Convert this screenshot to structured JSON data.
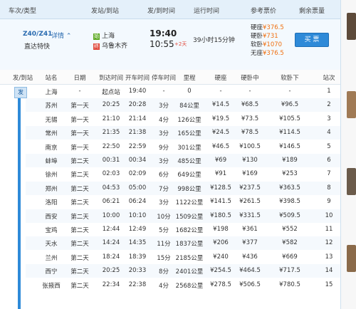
{
  "header": {
    "cols": [
      "车次/类型",
      "发站/到站",
      "发/到时间",
      "运行时间",
      "参考票价",
      "剩余票量"
    ]
  },
  "train": {
    "code": "Z40/Z41",
    "detail_label": "详情",
    "type": "直达特快",
    "from_tag": "始",
    "from": "上海",
    "to_tag": "终",
    "to": "乌鲁木齐",
    "depart": "19:40",
    "arrive": "10:55",
    "plus_days": "+2天",
    "duration": "39小时15分钟",
    "fares": [
      {
        "label": "硬座",
        "price": "¥376.5"
      },
      {
        "label": "硬卧",
        "price": "¥731"
      },
      {
        "label": "软卧",
        "price": "¥1070"
      },
      {
        "label": "无座",
        "price": "¥376.5"
      }
    ],
    "buy_label": "买 票"
  },
  "table": {
    "fa_label": "发",
    "columns": [
      "发/到站",
      "站名",
      "日期",
      "到达时间",
      "开车时间",
      "停车时间",
      "里程",
      "硬座",
      "硬卧中",
      "软卧下",
      "站次"
    ],
    "rows": [
      [
        "上海",
        "-",
        "起点站",
        "19:40",
        "-",
        "0",
        "-",
        "-",
        "-",
        "1"
      ],
      [
        "苏州",
        "第一天",
        "20:25",
        "20:28",
        "3分",
        "84公里",
        "¥14.5",
        "¥68.5",
        "¥96.5",
        "2"
      ],
      [
        "无锡",
        "第一天",
        "21:10",
        "21:14",
        "4分",
        "126公里",
        "¥19.5",
        "¥73.5",
        "¥105.5",
        "3"
      ],
      [
        "常州",
        "第一天",
        "21:35",
        "21:38",
        "3分",
        "165公里",
        "¥24.5",
        "¥78.5",
        "¥114.5",
        "4"
      ],
      [
        "南京",
        "第一天",
        "22:50",
        "22:59",
        "9分",
        "301公里",
        "¥46.5",
        "¥100.5",
        "¥146.5",
        "5"
      ],
      [
        "蚌埠",
        "第二天",
        "00:31",
        "00:34",
        "3分",
        "485公里",
        "¥69",
        "¥130",
        "¥189",
        "6"
      ],
      [
        "徐州",
        "第二天",
        "02:03",
        "02:09",
        "6分",
        "649公里",
        "¥91",
        "¥169",
        "¥253",
        "7"
      ],
      [
        "郑州",
        "第二天",
        "04:53",
        "05:00",
        "7分",
        "998公里",
        "¥128.5",
        "¥237.5",
        "¥363.5",
        "8"
      ],
      [
        "洛阳",
        "第二天",
        "06:21",
        "06:24",
        "3分",
        "1122公里",
        "¥141.5",
        "¥261.5",
        "¥398.5",
        "9"
      ],
      [
        "西安",
        "第二天",
        "10:00",
        "10:10",
        "10分",
        "1509公里",
        "¥180.5",
        "¥331.5",
        "¥509.5",
        "10"
      ],
      [
        "宝鸡",
        "第二天",
        "12:44",
        "12:49",
        "5分",
        "1682公里",
        "¥198",
        "¥361",
        "¥552",
        "11"
      ],
      [
        "天水",
        "第二天",
        "14:24",
        "14:35",
        "11分",
        "1837公里",
        "¥206",
        "¥377",
        "¥582",
        "12"
      ],
      [
        "兰州",
        "第二天",
        "18:24",
        "18:39",
        "15分",
        "2185公里",
        "¥240",
        "¥436",
        "¥669",
        "13"
      ],
      [
        "西宁",
        "第二天",
        "20:25",
        "20:33",
        "8分",
        "2401公里",
        "¥254.5",
        "¥464.5",
        "¥717.5",
        "14"
      ],
      [
        "张掖西",
        "第二天",
        "22:34",
        "22:38",
        "4分",
        "2568公里",
        "¥278.5",
        "¥506.5",
        "¥780.5",
        "15"
      ]
    ]
  },
  "colors": {
    "accent": "#2e8ad8",
    "price": "#f07010",
    "header_bg": "#e4f0fa"
  }
}
